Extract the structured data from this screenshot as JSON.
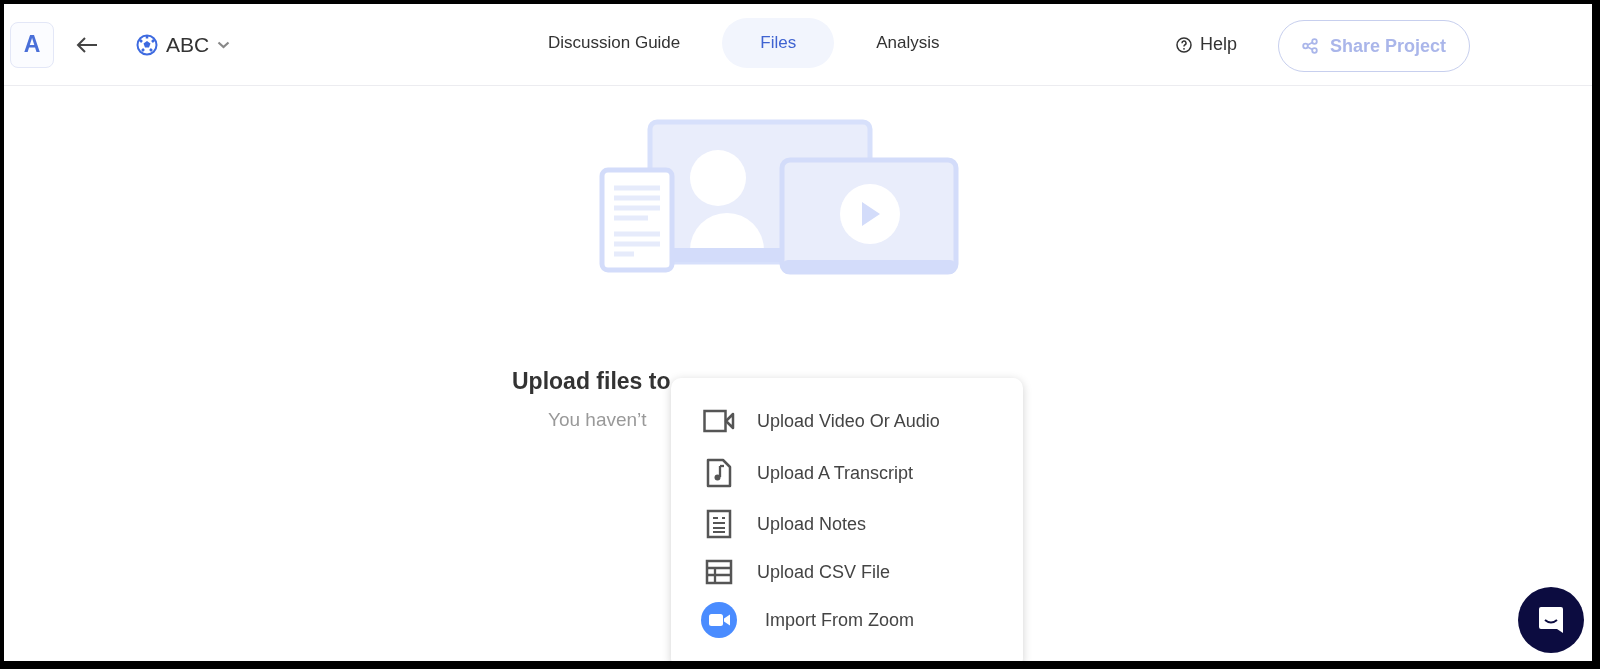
{
  "logo": {
    "letter": "A"
  },
  "project": {
    "name": "ABC"
  },
  "tabs": [
    {
      "label": "Discussion Guide",
      "selected": false
    },
    {
      "label": "Files",
      "selected": true
    },
    {
      "label": "Analysis",
      "selected": false
    }
  ],
  "help": {
    "label": "Help"
  },
  "share_button": {
    "label": "Share Project",
    "disabled": true
  },
  "empty_state": {
    "heading": "Upload files to",
    "subtitle": "You haven’t"
  },
  "upload_menu": [
    {
      "kind": "video",
      "label": "Upload Video Or Audio"
    },
    {
      "kind": "transcript",
      "label": "Upload A Transcript"
    },
    {
      "kind": "notes",
      "label": "Upload Notes"
    },
    {
      "kind": "csv",
      "label": "Upload CSV File"
    },
    {
      "kind": "zoom",
      "label": "Import From Zoom"
    }
  ]
}
